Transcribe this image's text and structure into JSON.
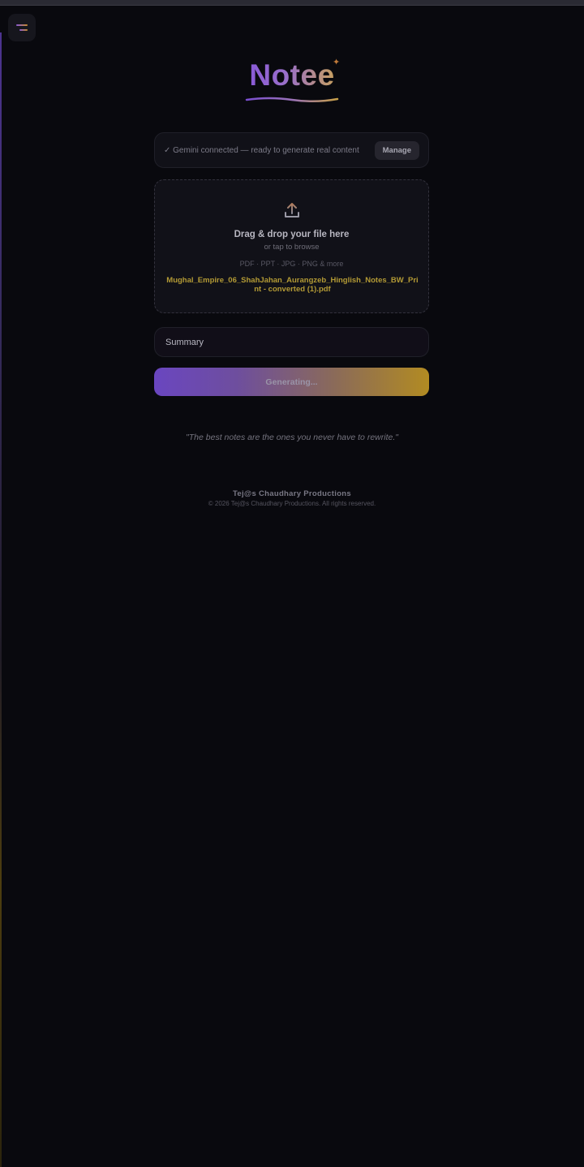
{
  "app": {
    "name": "Notee",
    "menu_icon": "hamburger-menu-icon"
  },
  "status": {
    "text": "✓ Gemini connected — ready to generate real content",
    "manage_label": "Manage"
  },
  "upload": {
    "icon": "upload-icon",
    "title": "Drag & drop your file here",
    "subtitle": "or tap to browse",
    "formats": "PDF · PPT · JPG · PNG & more",
    "file_name": "Mughal_Empire_06_ShahJahan_Aurangzeb_Hinglish_Notes_BW_Print - converted (1).pdf"
  },
  "mode": {
    "selected": "Summary"
  },
  "generate": {
    "label": "Generating..."
  },
  "quote": "\"The best notes are the ones you never have to rewrite.\"",
  "footer": {
    "brand": "Tej@s Chaudhary Productions",
    "copyright": "© 2026 Tej@s Chaudhary Productions. All rights reserved."
  },
  "colors": {
    "background": "#09090e",
    "accent_purple": "#8a5ad8",
    "accent_gold": "#c7a060",
    "file_name": "#b39a35"
  }
}
